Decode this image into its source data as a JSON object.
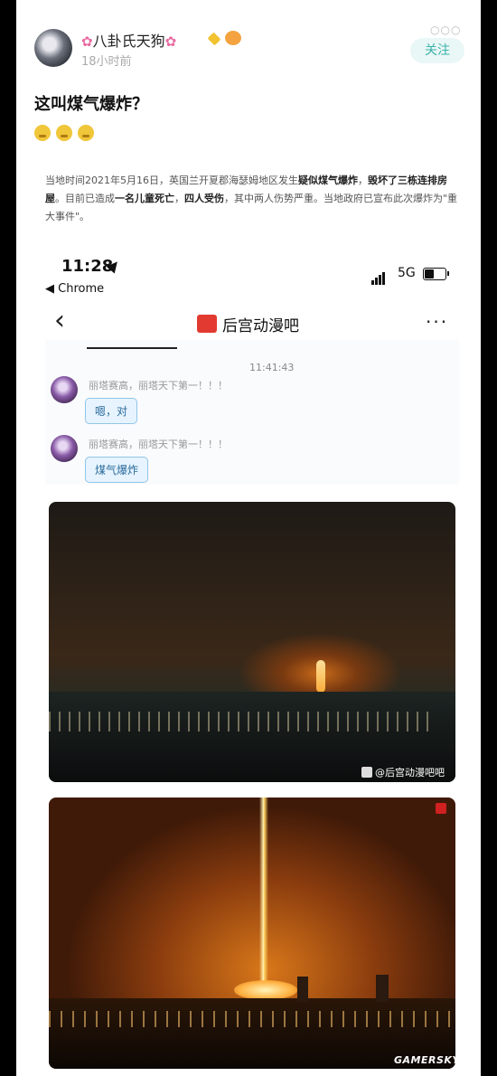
{
  "post": {
    "username": "八卦氏天狗",
    "flower": "✿",
    "time": "18小时前",
    "follow_label": "关注",
    "menu_dots": "○○○",
    "title": "这叫煤气爆炸？",
    "body": {
      "p1": "当地时间2021年5月16日，英国兰开夏郡海瑟姆地区发生",
      "b1": "疑似煤气爆炸",
      "p2": "，",
      "b2": "毁坏了三栋连排房屋",
      "p3": "。目前已造成",
      "b3": "一名儿童死亡",
      "p4": "，",
      "b4": "四人受伤",
      "p5": "，其中两人伤势严重。当地政府已宣布此次爆炸为\"重大事件\"。"
    }
  },
  "phone": {
    "status_time": "11:28",
    "back_app": "◀ Chrome",
    "network": "5G",
    "group_name": "后宫动漫吧",
    "nav_back": "‹",
    "nav_more": "···"
  },
  "chat": {
    "timestamp": "11:41:43",
    "messages": [
      {
        "sender": "丽塔赛高，丽塔天下第一！！！",
        "text": "嗯，对"
      },
      {
        "sender": "丽塔赛高，丽塔天下第一！！！",
        "text": "煤气爆炸"
      }
    ]
  },
  "photos": {
    "watermark": "@后宫动漫吧吧"
  },
  "site_watermark": "GAMERSKY",
  "icons": {
    "location": "location-arrow-icon",
    "signal": "signal-icon",
    "battery": "battery-icon",
    "back": "back-chevron-icon",
    "more": "more-dots-icon"
  }
}
